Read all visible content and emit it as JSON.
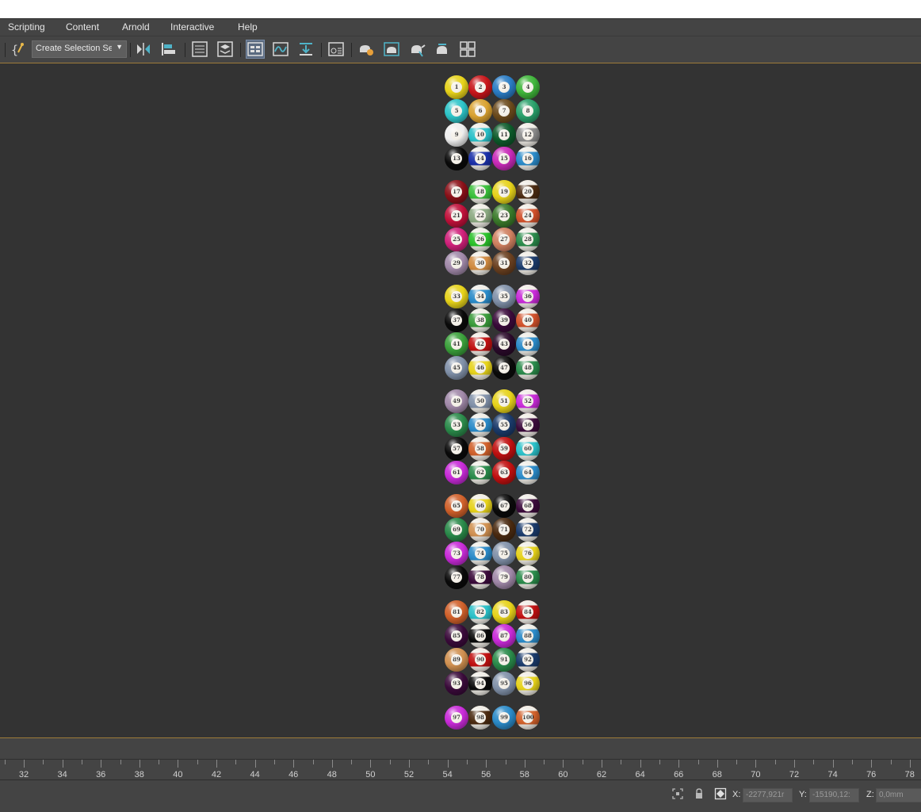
{
  "menu": [
    "Scripting",
    "Content",
    "Arnold",
    "Interactive",
    "Help"
  ],
  "toolbar": {
    "selection_dropdown": "Create Selection Se",
    "buttons": [
      "maxscript-icon",
      "mirror-icon",
      "align-icon",
      "scene-explorer-icon",
      "layer-explorer-icon",
      "ribbon-icon",
      "curve-editor-icon",
      "dope-sheet-icon",
      "schematic-view-icon",
      "render-setup-icon",
      "rendered-frame-window-icon",
      "render-teapot-icon",
      "render-iterative-icon",
      "arnold-render-icon"
    ]
  },
  "ball_colors": {
    "1": "#e6d21a",
    "2": "#c8161a",
    "3": "#2a7cc4",
    "4": "#3fb53a",
    "5": "#2cc4c8",
    "6": "#d9a230",
    "7": "#6b4a1c",
    "8": "#2aa06a",
    "9": "#eeeeee",
    "10": "#2ac0c8",
    "11": "#0c5a2a",
    "12": "#8a8a8a",
    "13": "#0a0a0a",
    "14": "#1a2fa8",
    "15": "#c82ab8",
    "16": "#2a8ac8",
    "17": "#8a1018",
    "18": "#3ac03a",
    "19": "#e6d21a",
    "20": "#4a2a10",
    "21": "#c0103a",
    "22": "#8aa880",
    "23": "#3a7a2a",
    "24": "#d0502a",
    "25": "#d0207a",
    "26": "#2ac02a",
    "27": "#d08060",
    "28": "#2a8a4a",
    "29": "#a088a8",
    "30": "#d08a40",
    "31": "#6a4020",
    "32": "#1a3a6a",
    "33": "#e6d21a",
    "34": "#2a8ac8",
    "35": "#8090a8",
    "36": "#c82ad8",
    "37": "#0a0a0a",
    "38": "#3a9a3a",
    "39": "#3a0a3a",
    "40": "#d0502a",
    "41": "#3aa03a",
    "42": "#c01010",
    "43": "#2a0a2a",
    "44": "#2a8ac8",
    "45": "#8090a8",
    "46": "#e6d21a",
    "47": "#0a0a0a",
    "48": "#2a8a4a",
    "49": "#a088a8",
    "50": "#8090a8",
    "51": "#e6d21a",
    "52": "#c82ad8",
    "53": "#2a8a4a",
    "54": "#2a8ac8",
    "55": "#1a3a6a",
    "56": "#3a0a3a",
    "57": "#0a0a0a",
    "58": "#d0602a",
    "59": "#c01010",
    "60": "#2ac0c8",
    "61": "#c82ad8",
    "62": "#2a8a4a",
    "63": "#c01010",
    "64": "#2a8ac8",
    "65": "#d0602a",
    "66": "#e6d21a",
    "67": "#0a0a0a",
    "68": "#3a0a3a",
    "69": "#2a8a4a",
    "70": "#d09050",
    "71": "#4a2a10",
    "72": "#1a3a6a",
    "73": "#c82ad8",
    "74": "#2a8ac8",
    "75": "#8090a8",
    "76": "#e6d21a",
    "77": "#0a0a0a",
    "78": "#3a0a3a",
    "79": "#a088a8",
    "80": "#2a8a4a",
    "81": "#d0602a",
    "82": "#2ac0c8",
    "83": "#e6d21a",
    "84": "#c01010",
    "85": "#3a0a3a",
    "86": "#0a0a0a",
    "87": "#c82ad8",
    "88": "#2a8ac8",
    "89": "#d09050",
    "90": "#c01010",
    "91": "#2a8a4a",
    "92": "#1a3a6a",
    "93": "#3a0a3a",
    "94": "#0a0a0a",
    "95": "#8090a8",
    "96": "#e6d21a",
    "97": "#c82ad8",
    "98": "#4a2a10",
    "99": "#2a8ac8",
    "100": "#d0602a"
  },
  "ruler": {
    "labels": [
      "32",
      "34",
      "36",
      "38",
      "40",
      "42",
      "44",
      "46",
      "48",
      "50",
      "52",
      "54",
      "56",
      "58",
      "60",
      "62",
      "64",
      "66",
      "68",
      "70",
      "72",
      "74",
      "76",
      "78"
    ]
  },
  "status": {
    "x_label": "X:",
    "x_value": "-2277,921r",
    "y_label": "Y:",
    "y_value": "-15190,12:",
    "z_label": "Z:",
    "z_value": "0,0mm"
  }
}
